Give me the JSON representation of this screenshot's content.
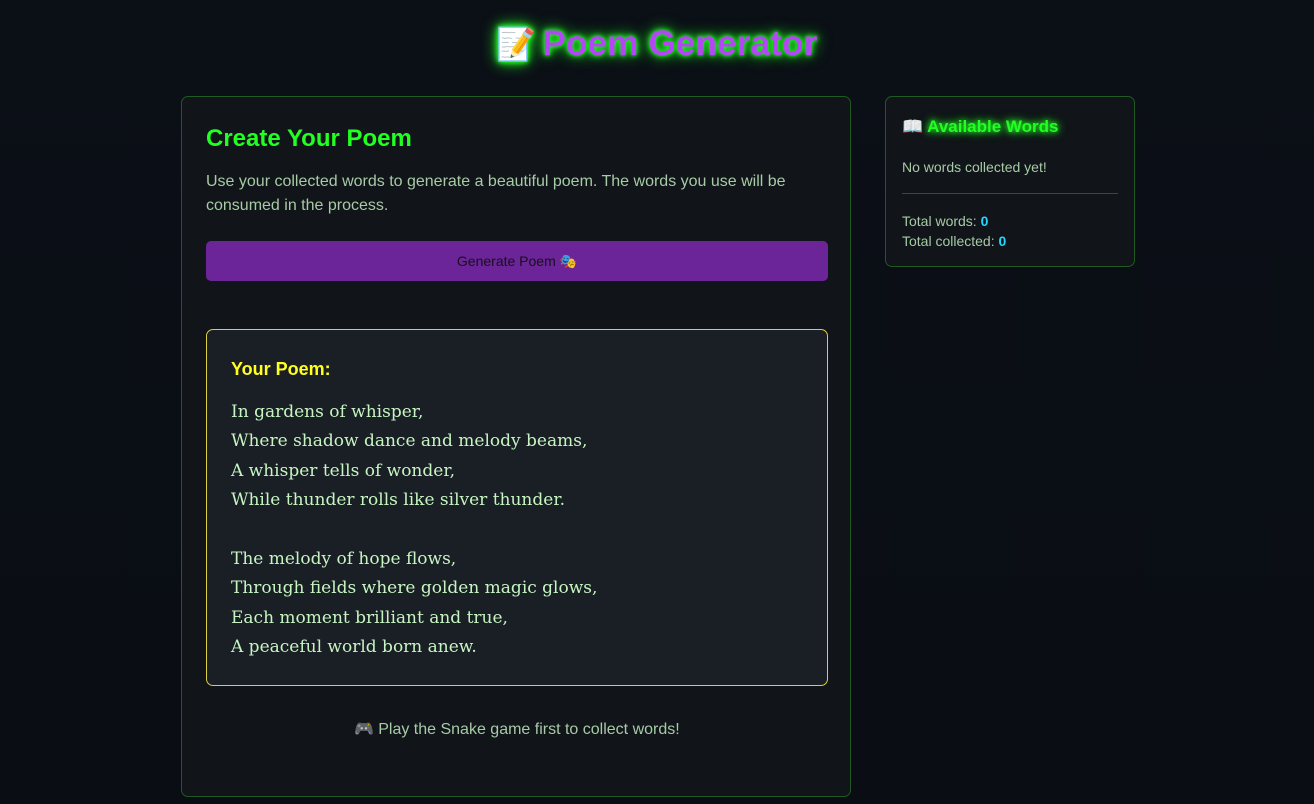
{
  "header": {
    "title_icon": "📝",
    "title": "Poem Generator"
  },
  "main": {
    "heading": "Create Your Poem",
    "description": "Use your collected words to generate a beautiful poem. The words you use will be consumed in the process.",
    "generate_button_label": "Generate Poem 🎭",
    "poem": {
      "heading": "Your Poem:",
      "lines": [
        "In gardens of whisper,",
        "Where shadow dance and melody beams,",
        "A whisper tells of wonder,",
        "While thunder rolls like silver thunder.",
        "",
        "The melody of hope flows,",
        "Through fields where golden magic glows,",
        "Each moment brilliant and true,",
        "A peaceful world born anew."
      ]
    },
    "footer_icon": "🎮",
    "footer_note": "Play the Snake game first to collect words!"
  },
  "sidebar": {
    "heading_icon": "📖",
    "heading": "Available Words",
    "empty_message": "No words collected yet!",
    "stats": {
      "total_words_label": "Total words:",
      "total_words_value": "0",
      "total_collected_label": "Total collected:",
      "total_collected_value": "0"
    }
  },
  "colors": {
    "accent_green": "#22ff22",
    "accent_purple": "#b347f5",
    "button_purple": "#6c2598",
    "poem_heading_yellow": "#ffff22",
    "stat_value_cyan": "#22d8ff"
  },
  "icons": {
    "title": "memo-icon",
    "button": "performing-arts-icon",
    "footer": "game-controller-icon",
    "sidebar": "open-book-icon"
  }
}
